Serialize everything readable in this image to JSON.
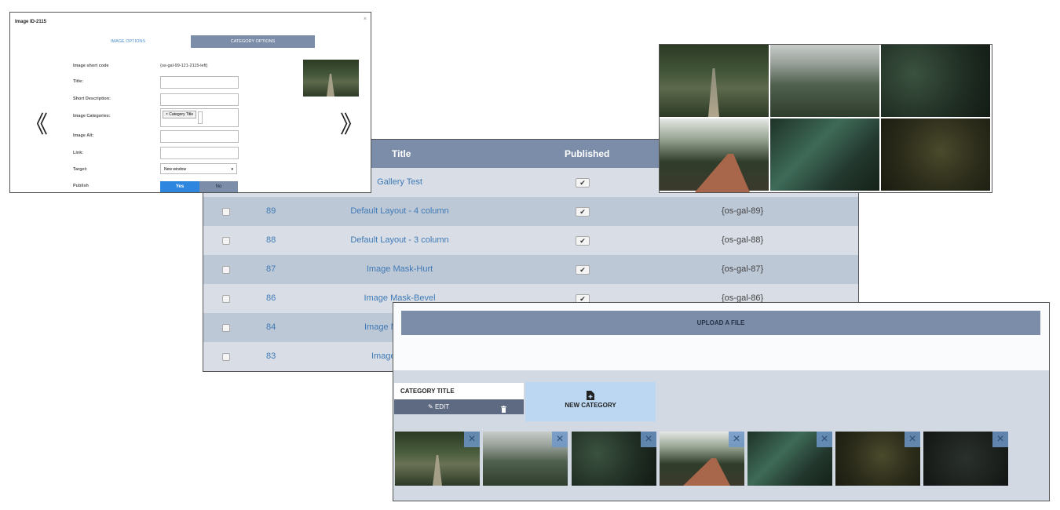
{
  "modal": {
    "title": "Image ID-2115",
    "close": "×",
    "tabs": {
      "image_options": "IMAGE OPTIONS",
      "category_options": "CATEGORY OPTIONS"
    },
    "fields": {
      "shortcode_label": "Image short code",
      "shortcode_value": "{os-gal-99-121-2115-left}",
      "title_label": "Title:",
      "short_desc_label": "Short Description:",
      "categories_label": "Image Categories:",
      "category_tag": "× Category Title",
      "alt_label": "Image Alt:",
      "link_label": "Link:",
      "target_label": "Target:",
      "target_value": "New window",
      "target_arrow": "▾",
      "publish_label": "Publish",
      "publish_yes": "Yes",
      "publish_no": "No"
    },
    "prev": "《",
    "next": "》"
  },
  "table": {
    "headers": {
      "title": "Title",
      "published": "Published"
    },
    "rows": [
      {
        "id": "",
        "title": "Gallery Test",
        "check": "✔",
        "code": ""
      },
      {
        "id": "89",
        "title": "Default Layout - 4 column",
        "check": "✔",
        "code": "{os-gal-89}"
      },
      {
        "id": "88",
        "title": "Default Layout - 3 column",
        "check": "✔",
        "code": "{os-gal-88}"
      },
      {
        "id": "87",
        "title": "Image Mask-Hurt",
        "check": "✔",
        "code": "{os-gal-87}"
      },
      {
        "id": "86",
        "title": "Image Mask-Bevel",
        "check": "✔",
        "code": "{os-gal-86}"
      },
      {
        "id": "84",
        "title": "Image Ma",
        "check": "",
        "code": ""
      },
      {
        "id": "83",
        "title": "Image",
        "check": "",
        "code": ""
      }
    ]
  },
  "upload": {
    "button": "UPLOAD A FILE",
    "category_title": "CATEGORY TITLE",
    "edit": "EDIT",
    "edit_icon": "✎",
    "trash_icon": "trash-icon",
    "new_category": "NEW CATEGORY",
    "new_category_icon": "file-plus-icon",
    "thumb_close": "×"
  },
  "colors": {
    "header_blue": "#7c8daa",
    "link_blue": "#3f79b5",
    "yes_blue": "#2e86de",
    "no_gray": "#7c8daa",
    "new_cat_bg": "#bcd7f1"
  }
}
